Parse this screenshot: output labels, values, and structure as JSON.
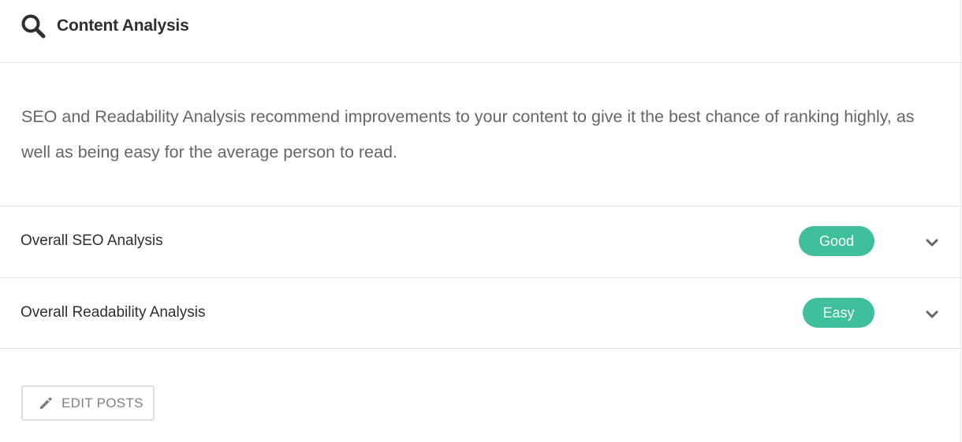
{
  "header": {
    "icon": "search-icon",
    "title": "Content Analysis"
  },
  "description": "SEO and Readability Analysis recommend improvements to your content to give it the best chance of ranking highly, as well as being easy for the average person to read.",
  "analyses": [
    {
      "label": "Overall SEO Analysis",
      "status": "Good",
      "status_color": "#3fbf9b",
      "icon": "chevron-down-icon"
    },
    {
      "label": "Overall Readability Analysis",
      "status": "Easy",
      "status_color": "#3fbf9b",
      "icon": "chevron-down-icon"
    }
  ],
  "edit_button": {
    "icon": "pencil-icon",
    "label": "EDIT POSTS"
  },
  "colors": {
    "accent": "#3fbf9b",
    "text_primary": "#2f2f2f",
    "text_secondary": "#666666",
    "divider": "#e3e3e3"
  }
}
